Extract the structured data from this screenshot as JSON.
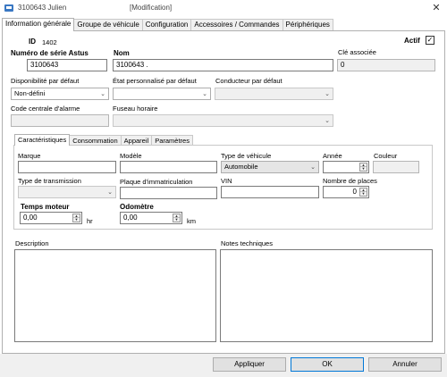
{
  "window": {
    "title": "3100643 Julien",
    "mode": "[Modification]",
    "close_glyph": "✕"
  },
  "main_tabs": [
    {
      "label": "Information générale",
      "active": true
    },
    {
      "label": "Groupe de véhicule",
      "active": false
    },
    {
      "label": "Configuration",
      "active": false
    },
    {
      "label": "Accessoires / Commandes",
      "active": false
    },
    {
      "label": "Périphériques",
      "active": false
    }
  ],
  "general": {
    "id_label": "ID",
    "id_value": "1402",
    "actif_label": "Actif",
    "actif_checked": true,
    "check_glyph": "✓",
    "serial_label": "Numéro de série Astus",
    "serial_value": "3100643",
    "name_label": "Nom",
    "name_value": "3100643 .",
    "key_label": "Clé associée",
    "key_value": "0",
    "availability_label": "Disponibilité par défaut",
    "availability_value": "Non-défini",
    "state_label": "État personnalisé par défaut",
    "state_value": "",
    "driver_label": "Conducteur par défaut",
    "driver_value": "",
    "alarm_label": "Code centrale d'alarme",
    "alarm_value": "",
    "timezone_label": "Fuseau horaire",
    "timezone_value": ""
  },
  "sub_tabs": [
    {
      "label": "Caractéristiques",
      "active": true
    },
    {
      "label": "Consommation",
      "active": false
    },
    {
      "label": "Appareil",
      "active": false
    },
    {
      "label": "Paramètres",
      "active": false
    }
  ],
  "characteristics": {
    "brand_label": "Marque",
    "brand_value": "",
    "model_label": "Modèle",
    "model_value": "",
    "vehicle_type_label": "Type de véhicule",
    "vehicle_type_value": "Automobile",
    "year_label": "Année",
    "year_value": "",
    "color_label": "Couleur",
    "color_value": "",
    "transmission_label": "Type de transmission",
    "transmission_value": "",
    "plate_label": "Plaque d'immatriculation",
    "plate_value": "",
    "vin_label": "VIN",
    "vin_value": "",
    "seats_label": "Nombre de places",
    "seats_value": "0",
    "engine_time_label": "Temps moteur",
    "engine_time_value": "0,00",
    "engine_time_unit": "hr",
    "odometer_label": "Odomètre",
    "odometer_value": "0,00",
    "odometer_unit": "km",
    "chevron_glyph": "⌄"
  },
  "notes": {
    "description_label": "Description",
    "technical_label": "Notes techniques"
  },
  "buttons": {
    "apply": "Appliquer",
    "ok": "OK",
    "cancel": "Annuler"
  },
  "colors": {
    "accent": "#0078d7",
    "panel_bg": "#ffffff",
    "footer_bg": "#f0f0f0"
  }
}
